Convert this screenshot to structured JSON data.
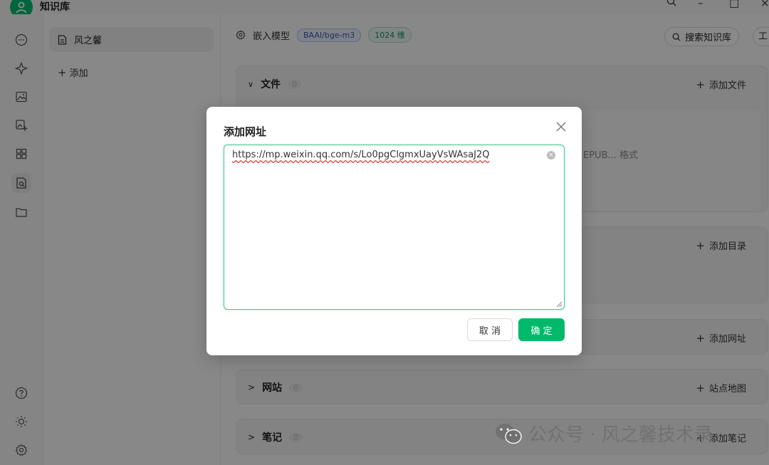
{
  "app": {
    "title": "知识库"
  },
  "window_controls": {
    "search": "search-icon",
    "minimize": "–",
    "maximize": "□",
    "close": "×"
  },
  "rail": {
    "items": [
      "chat-icon",
      "sparkle-icon",
      "image-icon",
      "image-edit-icon",
      "apps-grid-icon",
      "knowledge-icon",
      "folder-icon"
    ],
    "bottom": [
      "help-icon",
      "theme-icon",
      "settings-icon"
    ]
  },
  "kb_list": {
    "items": [
      {
        "label": "风之馨"
      }
    ],
    "add_label": "添加"
  },
  "main": {
    "embed_label": "嵌入模型",
    "model_tag": "BAAI/bge-m3",
    "dim_tag": "1024 维",
    "search_label": "搜索知识库",
    "tools_label": "工",
    "sections": [
      {
        "name": "文件",
        "count": "0",
        "action": "添加文件",
        "hint": "EPUB... 格式"
      },
      {
        "name": "",
        "count": "",
        "action": "添加目录"
      },
      {
        "name": "",
        "count": "",
        "action": "添加网址"
      },
      {
        "name": "网站",
        "count": "0",
        "action": "站点地图"
      },
      {
        "name": "笔记",
        "count": "0",
        "action": "添加笔记"
      }
    ]
  },
  "modal": {
    "title": "添加网址",
    "url_value": "https://mp.weixin.qq.com/s/Lo0pgClgmxUayVsWAsaJ2Q",
    "cancel_label": "取 消",
    "ok_label": "确 定"
  },
  "watermark": {
    "text": "公众号 · 风之馨技术录"
  },
  "colors": {
    "accent": "#00b96b"
  }
}
